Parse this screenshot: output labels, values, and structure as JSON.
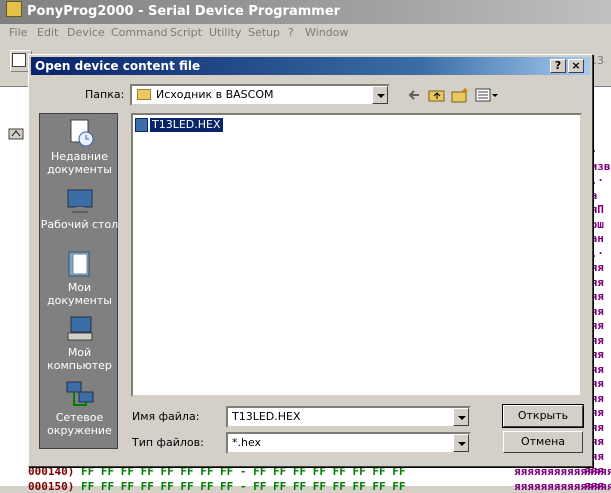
{
  "app": {
    "title": "PonyProg2000 - Serial Device Programmer",
    "menu": [
      "File",
      "Edit",
      "Device",
      "Command",
      "Script",
      "Utility",
      "Setup",
      "?",
      "Window"
    ],
    "toolbar_value": "13"
  },
  "hex": {
    "rows": [
      {
        "addr": "000140)",
        "bytes": "FF FF FF FF FF FF FF FF - FF FF FF FF FF FF FF FF",
        "ascii": "яяяяяяяяяяяяяяяя"
      },
      {
        "addr": "000150)",
        "bytes": "FF FF FF FF FF FF FF FF - FF FF FF FF FF FF FF FF",
        "ascii": "яяяяяяяяяяяяяяяя"
      }
    ],
    "right_column": [
      ".·",
      "мизв",
      "a.·",
      "Ѣа",
      "'яП",
      "'bш",
      "ран",
      "·.·",
      "яяя",
      "яяя",
      "яяя",
      "яяя",
      "яяя",
      "яяя",
      "яяя",
      "яяя",
      "яяя",
      "яяя",
      "яяя",
      "яяя",
      "яяя",
      "яяя",
      "яяя",
      "яяя"
    ]
  },
  "dialog": {
    "title": "Open device content file",
    "help_label": "?",
    "close_label": "×",
    "lookin_label": "Папка:",
    "lookin_value": "Исходник в BASCOM",
    "places": [
      {
        "label": "Недавние документы"
      },
      {
        "label": "Рабочий стол"
      },
      {
        "label": "Мои документы"
      },
      {
        "label": "Мой компьютер"
      },
      {
        "label": "Сетевое окружение"
      }
    ],
    "files": [
      {
        "name": "T13LED.HEX"
      }
    ],
    "filename_label": "Имя файла:",
    "filename_value": "T13LED.HEX",
    "filetype_label": "Тип файлов:",
    "filetype_value": "*.hex",
    "open_button": "Открыть",
    "cancel_button": "Отмена"
  }
}
